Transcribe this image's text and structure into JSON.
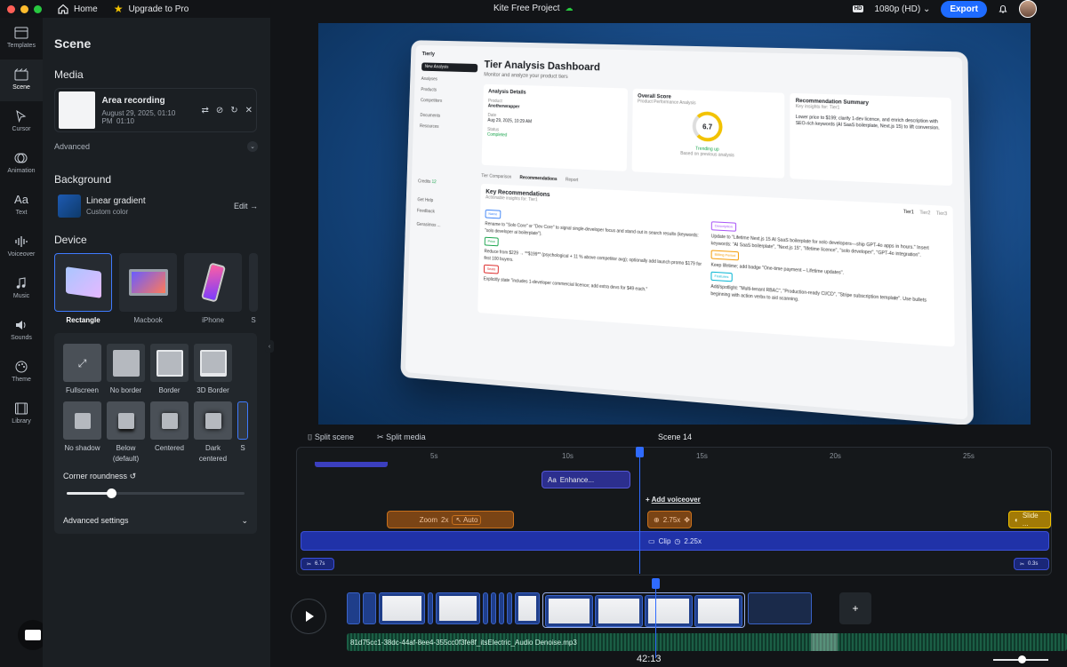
{
  "topbar": {
    "home": "Home",
    "upgrade": "Upgrade to Pro",
    "project_title": "Kite Free Project",
    "hd_badge": "HD",
    "resolution": "1080p (HD)",
    "export": "Export"
  },
  "rail": [
    {
      "label": "Templates",
      "icon": "templates-icon"
    },
    {
      "label": "Scene",
      "icon": "scene-icon"
    },
    {
      "label": "Cursor",
      "icon": "cursor-icon"
    },
    {
      "label": "Animation",
      "icon": "animation-icon"
    },
    {
      "label": "Text",
      "icon": "text-icon"
    },
    {
      "label": "Voiceover",
      "icon": "voiceover-icon"
    },
    {
      "label": "Music",
      "icon": "music-icon"
    },
    {
      "label": "Sounds",
      "icon": "sounds-icon"
    },
    {
      "label": "Theme",
      "icon": "theme-icon"
    },
    {
      "label": "Library",
      "icon": "library-icon"
    }
  ],
  "panel": {
    "title": "Scene",
    "media_title": "Media",
    "media": {
      "name": "Area recording",
      "date": "August 29, 2025, 01:10 PM",
      "duration": "01:10"
    },
    "advanced": "Advanced",
    "background_title": "Background",
    "background": {
      "name": "Linear gradient",
      "sub": "Custom color",
      "edit": "Edit"
    },
    "device_title": "Device",
    "devices": [
      "Rectangle",
      "Macbook",
      "iPhone",
      "S"
    ],
    "borders": [
      "Fullscreen",
      "No border",
      "Border",
      "3D Border"
    ],
    "shadows": [
      "No shadow",
      "Below (default)",
      "Centered",
      "Dark centered",
      "S"
    ],
    "corner_roundness": "Corner roundness",
    "corner_value": 0.25,
    "advanced_settings": "Advanced settings"
  },
  "preview": {
    "app_name": "Tierly",
    "nav": [
      "New Analysis",
      "Analyses",
      "Products",
      "Competitors",
      "Documents",
      "Resources",
      "Credits",
      "Get Help",
      "Feedback"
    ],
    "user": "Gerasimos ...",
    "credits_count": "12",
    "title": "Tier Analysis Dashboard",
    "subtitle": "Monitor and analyze your product tiers",
    "analysis_details": "Analysis Details",
    "product_label": "Product",
    "product": "Anotherwrapper",
    "date_label": "Date",
    "date": "Aug 29, 2025, 10:29 AM",
    "status_label": "Status",
    "status": "Completed",
    "overall_score": "Overall Score",
    "score_sub": "Product Performance Analysis",
    "score": "6.7",
    "trending": "Trending up",
    "based_on": "Based on previous analysis",
    "rec_summary": "Recommendation Summary",
    "rec_summary_sub": "Key insights for: Tier1",
    "rec_summary_text": "Lower price to $199; clarify 1-dev licence, and enrich description with SEO-rich keywords (AI SaaS boilerplate, Next.js 15) to lift conversion.",
    "tabs": [
      "Tier Comparison",
      "Recommendations",
      "Report"
    ],
    "key_recs": "Key Recommendations",
    "key_recs_sub": "Actionable insights for: Tier1",
    "tiers": [
      "Tier1",
      "Tier2",
      "Tier3"
    ],
    "recs_left": [
      {
        "tag": "Name",
        "text": "Rename to \"Solo Core\" or \"Dev Core\" to signal single-developer focus and stand out in search results (keywords: \"solo developer ai boilerplate\")."
      },
      {
        "tag": "Price",
        "text": "Reduce from $229 → **$199** (psychological + 11 % above competitor avg); optionally add launch promo $179 for first 100 buyers."
      },
      {
        "tag": "Seats",
        "text": "Explicitly state \"includes 1-developer commercial licence; add extra devs for $49 each.\""
      }
    ],
    "recs_right": [
      {
        "tag": "Description",
        "text": "Update to \"Lifetime Next.js 15 AI SaaS boilerplate for solo developers—ship GPT-4o apps in hours.\" Insert keywords: \"AI SaaS boilerplate\", \"Next.js 15\", \"lifetime licence\", \"solo developer\", \"GPT-4o integration\"."
      },
      {
        "tag": "Billing Period",
        "text": "Keep lifetime; add badge \"One-time payment – Lifetime updates\"."
      },
      {
        "tag": "Features",
        "text": "Add/spotlight: \"Multi-tenant RBAC\", \"Production-ready CI/CD\", \"Stripe subscription template\". Use bullets beginning with action verbs to aid scanning."
      }
    ]
  },
  "timeline": {
    "split_scene": "Split scene",
    "split_media": "Split media",
    "scene_label": "Scene 14",
    "ruler": [
      "5s",
      "10s",
      "15s",
      "20s",
      "25s"
    ],
    "enhance": "Enhance...",
    "add_voiceover": "Add voiceover",
    "zoom_label": "Zoom",
    "zoom_value": "2x",
    "zoom_auto": "Auto",
    "zoom2": "2.75x",
    "slide": "Slide ...",
    "clip_label": "Clip",
    "clip_speed": "2.25x",
    "cut_left": "6.7s",
    "cut_right": "0.3s"
  },
  "audio_file": "81d75cc1-38dc-44af-8ee4-355cc0f3fe8f_itsElectric_Audio Denoise.mp3",
  "timecode": "42:13",
  "colors": {
    "accent": "#1e6bff",
    "zoom": "#c8701c",
    "clip": "#2032a8",
    "slide": "#f2c200"
  }
}
